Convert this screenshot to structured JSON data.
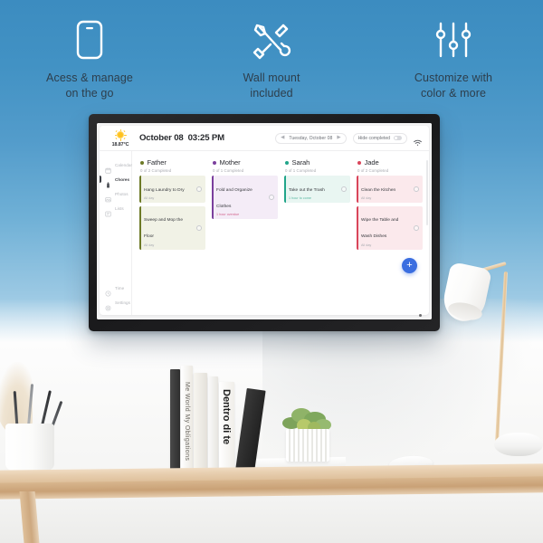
{
  "features": [
    {
      "icon": "phone-icon",
      "line1": "Acess & manage",
      "line2": "on the go"
    },
    {
      "icon": "tools-icon",
      "line1": "Wall mount",
      "line2": "included"
    },
    {
      "icon": "sliders-icon",
      "line1": "Customize with",
      "line2": "color & more"
    }
  ],
  "display": {
    "header": {
      "weather_icon": "sun-icon",
      "temperature": "18.87°C",
      "date": "October 08",
      "time": "03:25 PM",
      "date_nav": {
        "prev_icon": "chevron-left-icon",
        "label": "Tuesday, October 08",
        "next_icon": "chevron-right-icon"
      },
      "hide_completed_label": "Hide completed",
      "hide_completed_on": false,
      "wifi_icon": "wifi-icon"
    },
    "sidebar": [
      {
        "id": "calendar",
        "label": "Calendar",
        "icon": "calendar-icon",
        "active": false
      },
      {
        "id": "chores",
        "label": "Chores",
        "icon": "chores-icon",
        "active": true
      },
      {
        "id": "photos",
        "label": "Photos",
        "icon": "photos-icon",
        "active": false
      },
      {
        "id": "lists",
        "label": "Lists",
        "icon": "lists-icon",
        "active": false
      },
      {
        "id": "time",
        "label": "Time",
        "icon": "clock-icon",
        "active": false
      },
      {
        "id": "settings",
        "label": "Settings",
        "icon": "gear-icon",
        "active": false
      }
    ],
    "columns": [
      {
        "name": "Father",
        "color": "#6d7a27",
        "card_bg": "#f1f2e6",
        "subtitle": "0 of 2 Completed",
        "tasks": [
          {
            "title": "Hang Laundry to Dry",
            "meta": "All day",
            "meta_kind": "muted"
          },
          {
            "title": "Sweep and Mop the Floor",
            "meta": "All day",
            "meta_kind": "muted"
          }
        ]
      },
      {
        "name": "Mother",
        "color": "#7b3f9d",
        "card_bg": "#f4ecf7",
        "subtitle": "0 of 1 Completed",
        "tasks": [
          {
            "title": "Fold and Organize Clothes",
            "meta": "1 hour overdue",
            "meta_kind": "alert",
            "meta_color": "#d1628b"
          }
        ]
      },
      {
        "name": "Sarah",
        "color": "#21a58a",
        "card_bg": "#e9f6f2",
        "subtitle": "0 of 1 Completed",
        "tasks": [
          {
            "title": "Take out the Trash",
            "meta": "1 hour to come",
            "meta_kind": "alert",
            "meta_color": "#57b8a0"
          }
        ]
      },
      {
        "name": "Jade",
        "color": "#d9455a",
        "card_bg": "#fbe9ec",
        "subtitle": "0 of 2 Completed",
        "tasks": [
          {
            "title": "Clean the Kitchen",
            "meta": "All day",
            "meta_kind": "muted"
          },
          {
            "title": "Wipe the Table and Wash Dishes",
            "meta": "All day",
            "meta_kind": "muted"
          }
        ]
      }
    ],
    "fab": {
      "icon": "plus-icon",
      "label": "+",
      "color": "#3b6ee0"
    }
  },
  "scene": {
    "books": [
      {
        "title": "",
        "spine_color": "#3f3f3f",
        "text_color": "#d9d9d9"
      },
      {
        "title": "Me World My Obligations",
        "spine_color": "#f3f1ec",
        "text_color": "#6d6a64"
      },
      {
        "title": "",
        "spine_color": "#efeee9",
        "text_color": "#8b8880"
      },
      {
        "title": "Dentro di te",
        "spine_color": "#ffffff",
        "text_color": "#242424"
      },
      {
        "title": "",
        "spine_color": "#2b2b2b",
        "text_color": "#cfcfcf"
      }
    ],
    "props": [
      "pen-pot",
      "plant",
      "computer-mouse",
      "desk-lamp",
      "stylus",
      "paper"
    ]
  },
  "colors": {
    "sky_top": "#3c8cc0",
    "sky_bottom": "#ffffff",
    "caption_text": "#2d3e4c",
    "tv_frame": "#1f1f21",
    "accent_blue": "#3b6ee0"
  }
}
